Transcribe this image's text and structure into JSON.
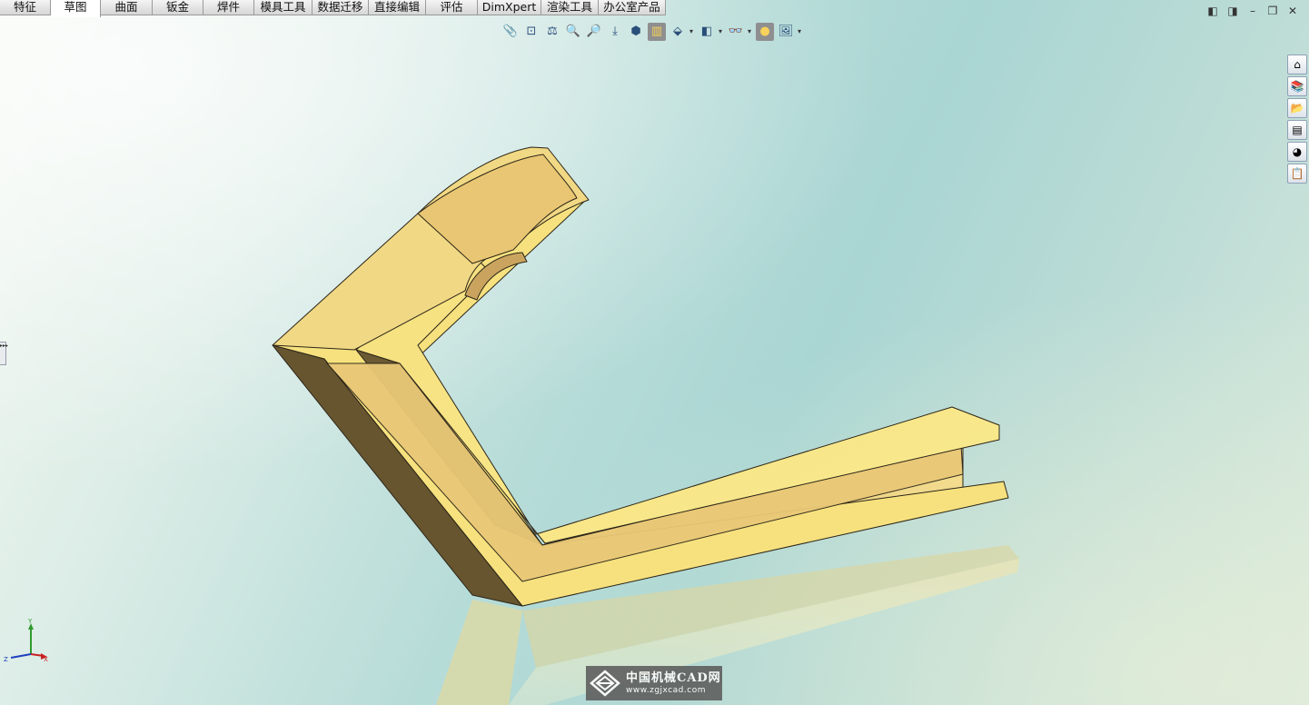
{
  "tabs": [
    {
      "label": "特征",
      "active": false
    },
    {
      "label": "草图",
      "active": true
    },
    {
      "label": "曲面",
      "active": false
    },
    {
      "label": "钣金",
      "active": false
    },
    {
      "label": "焊件",
      "active": false
    },
    {
      "label": "模具工具",
      "active": false
    },
    {
      "label": "数据迁移",
      "active": false
    },
    {
      "label": "直接编辑",
      "active": false
    },
    {
      "label": "评估",
      "active": false
    },
    {
      "label": "DimXpert",
      "active": false
    },
    {
      "label": "渲染工具",
      "active": false
    },
    {
      "label": "办公室产品",
      "active": false
    }
  ],
  "window_controls": [
    {
      "name": "pane-left-icon",
      "glyph": "◧"
    },
    {
      "name": "pane-right-icon",
      "glyph": "◨"
    },
    {
      "name": "minimize-icon",
      "glyph": "–"
    },
    {
      "name": "restore-icon",
      "glyph": "❐"
    },
    {
      "name": "close-icon",
      "glyph": "✕"
    }
  ],
  "heads_up_toolbar": [
    {
      "name": "measure-icon",
      "glyph": "📎"
    },
    {
      "name": "zoom-to-fit-icon",
      "glyph": "⊡"
    },
    {
      "name": "zoom-to-area-icon",
      "glyph": "⚖"
    },
    {
      "name": "zoom-in-out-icon",
      "glyph": "🔍"
    },
    {
      "name": "zoom-selection-icon",
      "glyph": "🔎"
    },
    {
      "name": "rotate-view-icon",
      "glyph": "⤓"
    },
    {
      "name": "standard-views-icon",
      "glyph": "⬢"
    },
    {
      "name": "section-view-icon",
      "glyph": "▥",
      "pressed": true
    },
    {
      "name": "view-orientation-icon",
      "glyph": "⬙",
      "dropdown": true
    },
    {
      "name": "display-style-icon",
      "glyph": "◧",
      "dropdown": true
    },
    {
      "name": "hide-show-items-icon",
      "glyph": "👓",
      "dropdown": true
    },
    {
      "name": "edit-appearance-icon",
      "glyph": "●",
      "pressed": true
    },
    {
      "name": "apply-scene-icon",
      "glyph": "🖼",
      "dropdown": true
    }
  ],
  "task_pane": [
    {
      "name": "solidworks-resources-icon",
      "glyph": "⌂"
    },
    {
      "name": "design-library-icon",
      "glyph": "📚"
    },
    {
      "name": "file-explorer-icon",
      "glyph": "📂"
    },
    {
      "name": "view-palette-icon",
      "glyph": "▤"
    },
    {
      "name": "appearances-scenes-icon",
      "glyph": "◕"
    },
    {
      "name": "custom-properties-icon",
      "glyph": "📋"
    }
  ],
  "left_handle_glyph": "▸▸▸",
  "triad": {
    "x_label": "X",
    "y_label": "Y",
    "z_label": "Z"
  },
  "watermark": {
    "text_cn": "中国机械CAD网",
    "url": "www.zgjxcad.com"
  },
  "colors": {
    "part_face_light": "#f8e88a",
    "part_face_mid": "#efd27e",
    "part_face_side": "#e0bd6a",
    "part_face_dark": "#675530",
    "accent_pressed": "#8f8f8f"
  }
}
